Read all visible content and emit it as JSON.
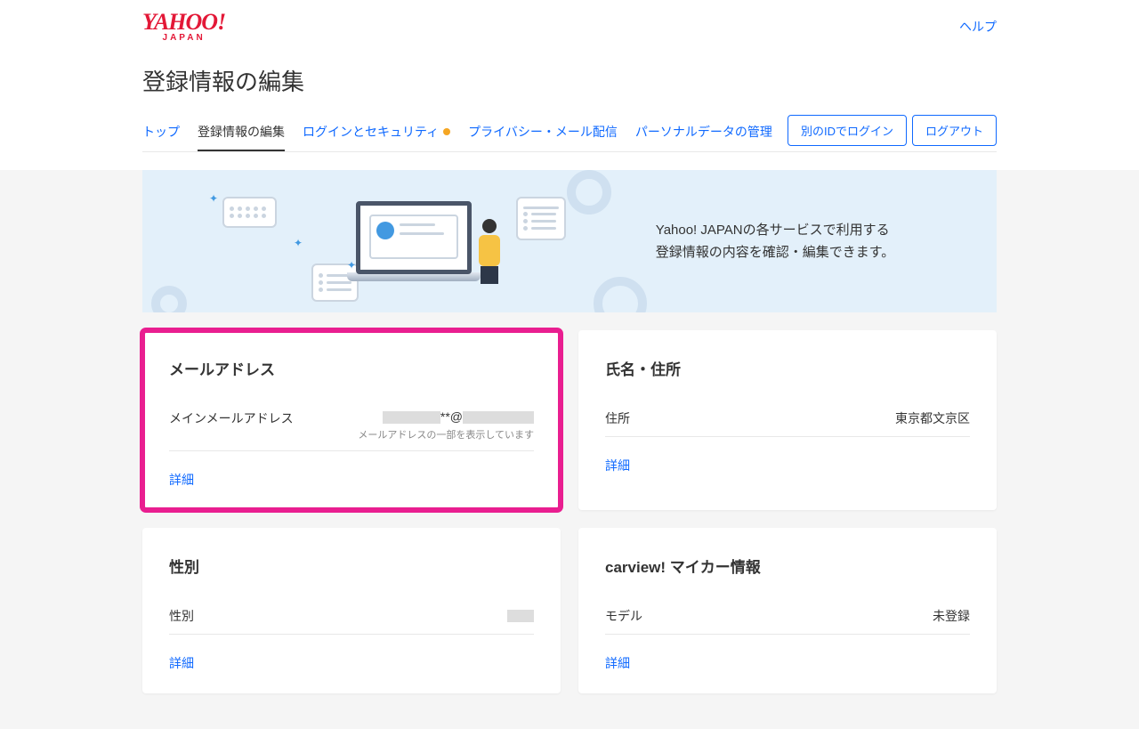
{
  "header": {
    "logo_main": "YAHOO!",
    "logo_sub": "JAPAN",
    "help": "ヘルプ"
  },
  "page_title": "登録情報の編集",
  "nav": {
    "items": [
      {
        "label": "トップ"
      },
      {
        "label": "登録情報の編集"
      },
      {
        "label": "ログインとセキュリティ"
      },
      {
        "label": "プライバシー・メール配信"
      },
      {
        "label": "パーソナルデータの管理"
      }
    ],
    "buttons": {
      "other_id": "別のIDでログイン",
      "logout": "ログアウト"
    }
  },
  "banner": {
    "line1": "Yahoo! JAPANの各サービスで利用する",
    "line2": "登録情報の内容を確認・編集できます。"
  },
  "cards": {
    "email": {
      "title": "メールアドレス",
      "row_label": "メインメールアドレス",
      "value_mid": "**@",
      "note": "メールアドレスの一部を表示しています",
      "link": "詳細"
    },
    "name_address": {
      "title": "氏名・住所",
      "row_label": "住所",
      "value": "東京都文京区",
      "link": "詳細"
    },
    "gender": {
      "title": "性別",
      "row_label": "性別",
      "link": "詳細"
    },
    "carview": {
      "title": "carview! マイカー情報",
      "row_label": "モデル",
      "value": "未登録",
      "link": "詳細"
    }
  }
}
